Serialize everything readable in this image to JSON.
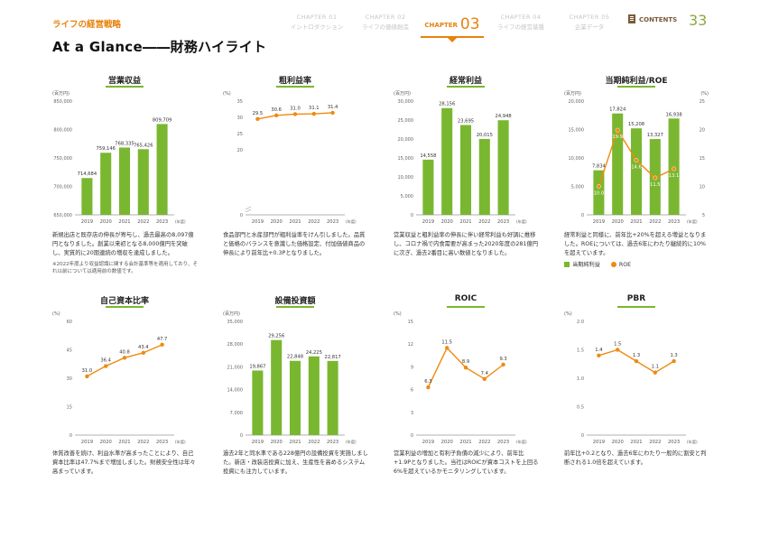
{
  "header": {
    "brand": "ライフの経営戦略",
    "tabs": [
      {
        "line1": "CHAPTER 01",
        "line2": "イントロダクション"
      },
      {
        "line1": "CHAPTER 02",
        "line2": "ライフの価値創造"
      },
      {
        "line1": "CHAPTER",
        "num": "03",
        "active": true
      },
      {
        "line1": "CHAPTER 04",
        "line2": "ライフの経営基盤"
      },
      {
        "line1": "CHAPTER 05",
        "line2": "企業データ"
      }
    ],
    "contents_label": "CONTENTS",
    "page_number": "33"
  },
  "page_title": "At a Glance――財務ハイライト",
  "colors": {
    "bar": "#7ab730",
    "line": "#ef8a10",
    "accent": "#e8820c",
    "axis": "#999999"
  },
  "panels": [
    {
      "title": "営業収益",
      "description": "新規出店と既存店の伸長が寄与し、過去最高の8,097億円となりました。創業以来初となる8,000億円を突破し、実質的に20期連続の増収を達成しました。",
      "note": "※2022年度より収益認識に関する会計基準等を適用しており、それ以前については適用前の数値です。",
      "chart_data": {
        "type": "bar",
        "categories": [
          "2019",
          "2020",
          "2021",
          "2022",
          "2023"
        ],
        "values": [
          714684,
          759146,
          768335,
          765426,
          809709
        ],
        "value_labels": [
          "714,684",
          "759,146",
          "768,335",
          "765,426",
          "809,709"
        ],
        "unit": "(百万円)",
        "x_unit": "(年度)",
        "ylim": [
          650000,
          850000
        ],
        "yticks": [
          650000,
          700000,
          750000,
          800000,
          850000
        ],
        "ytick_labels": [
          "650,000",
          "700,000",
          "750,000",
          "800,000",
          "850,000"
        ]
      }
    },
    {
      "title": "粗利益率",
      "description": "食品部門と水産部門が粗利益率をけん引しました。品質と価格のバランスを意識した価格設定、付加価値商品の伸長により前年比+0.3Pとなりました。",
      "chart_data": {
        "type": "line",
        "categories": [
          "2019",
          "2020",
          "2021",
          "2022",
          "2023"
        ],
        "values": [
          29.5,
          30.6,
          31.0,
          31.1,
          31.4
        ],
        "value_labels": [
          "29.5",
          "30.6",
          "31.0",
          "31.1",
          "31.4"
        ],
        "unit": "(%)",
        "x_unit": "(年度)",
        "ylim": [
          0,
          35
        ],
        "yticks": [
          0,
          20,
          25,
          30,
          35
        ],
        "ytick_labels": [
          "0",
          "20",
          "25",
          "30",
          "35"
        ],
        "scale_break": true
      }
    },
    {
      "title": "経常利益",
      "description": "営業収益と粗利益率の伸長に伴い経常利益も好調に推移し、コロナ禍で内食需要が高まった2020年度の281億円に次ぎ、過去2番目に高い数値となりました。",
      "chart_data": {
        "type": "bar",
        "categories": [
          "2019",
          "2020",
          "2021",
          "2022",
          "2023"
        ],
        "values": [
          14558,
          28156,
          23695,
          20015,
          24948
        ],
        "value_labels": [
          "14,558",
          "28,156",
          "23,695",
          "20,015",
          "24,948"
        ],
        "unit": "(百万円)",
        "x_unit": "(年度)",
        "ylim": [
          0,
          30000
        ],
        "yticks": [
          0,
          5000,
          10000,
          15000,
          20000,
          25000,
          30000
        ],
        "ytick_labels": [
          "0",
          "5,000",
          "10,000",
          "15,000",
          "20,000",
          "25,000",
          "30,000"
        ]
      }
    },
    {
      "title": "当期純利益/ROE",
      "description": "経常利益と同様に、前年比+20%を超える増益となりました。ROEについては、過去6年にわたり継続的に10%を超えています。",
      "legend": {
        "bar": "当期純利益",
        "line": "ROE"
      },
      "chart_data": {
        "type": "bar",
        "categories": [
          "2019",
          "2020",
          "2021",
          "2022",
          "2023"
        ],
        "values": [
          7834,
          17824,
          15208,
          13327,
          16938
        ],
        "value_labels": [
          "7,834",
          "17,824",
          "15,208",
          "13,327",
          "16,938"
        ],
        "unit": "(百万円)",
        "x_unit": "(年度)",
        "ylim": [
          0,
          20000
        ],
        "yticks": [
          0,
          5000,
          10000,
          15000,
          20000
        ],
        "ytick_labels": [
          "0",
          "5,000",
          "10,000",
          "15,000",
          "20,000"
        ],
        "secondary": {
          "type": "line",
          "values": [
            10.0,
            19.9,
            14.6,
            11.5,
            13.1
          ],
          "value_labels": [
            "10.0",
            "19.9",
            "14.6",
            "11.5",
            "13.1"
          ],
          "unit": "(%)",
          "ylim": [
            5,
            25
          ],
          "yticks": [
            5,
            10,
            15,
            20,
            25
          ],
          "ytick_labels": [
            "5",
            "10",
            "15",
            "20",
            "25"
          ]
        }
      }
    },
    {
      "title": "自己資本比率",
      "description": "体質改善を続け、利益水準が高まったことにより、自己資本比率は47.7%まで増加しました。財務安全性は年々高まっています。",
      "chart_data": {
        "type": "line",
        "categories": [
          "2019",
          "2020",
          "2021",
          "2022",
          "2023"
        ],
        "values": [
          31.0,
          36.4,
          40.8,
          43.4,
          47.7
        ],
        "value_labels": [
          "31.0",
          "36.4",
          "40.8",
          "43.4",
          "47.7"
        ],
        "unit": "(%)",
        "x_unit": "(年度)",
        "ylim": [
          0,
          60
        ],
        "yticks": [
          0,
          15,
          30,
          45,
          60
        ],
        "ytick_labels": [
          "0",
          "15",
          "30",
          "45",
          "60"
        ]
      }
    },
    {
      "title": "設備投資額",
      "description": "過去2年と同水準である228億円の設備投資を実施しました。新店・改装店投資に加え、生産性を高めるシステム投資にも注力しています。",
      "chart_data": {
        "type": "bar",
        "categories": [
          "2019",
          "2020",
          "2021",
          "2022",
          "2023"
        ],
        "values": [
          19867,
          29256,
          22848,
          24225,
          22817
        ],
        "value_labels": [
          "19,867",
          "29,256",
          "22,848",
          "24,225",
          "22,817"
        ],
        "unit": "(百万円)",
        "x_unit": "(年度)",
        "ylim": [
          0,
          35000
        ],
        "yticks": [
          0,
          7000,
          14000,
          21000,
          28000,
          35000
        ],
        "ytick_labels": [
          "0",
          "7,000",
          "14,000",
          "21,000",
          "28,000",
          "35,000"
        ]
      }
    },
    {
      "title": "ROIC",
      "description": "営業利益の増加と有利子負債の減少により、前年比+1.9Pとなりました。当社はROICが資本コストを上回る6%を超えているかモニタリングしています。",
      "chart_data": {
        "type": "line",
        "categories": [
          "2019",
          "2020",
          "2021",
          "2022",
          "2023"
        ],
        "values": [
          6.3,
          11.5,
          8.9,
          7.4,
          9.3
        ],
        "value_labels": [
          "6.3",
          "11.5",
          "8.9",
          "7.4",
          "9.3"
        ],
        "unit": "(%)",
        "x_unit": "(年度)",
        "ylim": [
          0,
          15
        ],
        "yticks": [
          0,
          3,
          6,
          9,
          12,
          15
        ],
        "ytick_labels": [
          "0",
          "3",
          "6",
          "9",
          "12",
          "15"
        ]
      }
    },
    {
      "title": "PBR",
      "description": "前年比+0.2となり、過去6年にわたり一般的に割安と判断される1.0倍を超えています。",
      "chart_data": {
        "type": "line",
        "categories": [
          "2019",
          "2020",
          "2021",
          "2022",
          "2023"
        ],
        "values": [
          1.4,
          1.5,
          1.3,
          1.1,
          1.3
        ],
        "value_labels": [
          "1.4",
          "1.5",
          "1.3",
          "1.1",
          "1.3"
        ],
        "unit": "(%)",
        "x_unit": "(年度)",
        "ylim": [
          0,
          2.0
        ],
        "yticks": [
          0,
          0.5,
          1.0,
          1.5,
          2.0
        ],
        "ytick_labels": [
          "0",
          "0.5",
          "1.0",
          "1.5",
          "2.0"
        ]
      }
    }
  ]
}
